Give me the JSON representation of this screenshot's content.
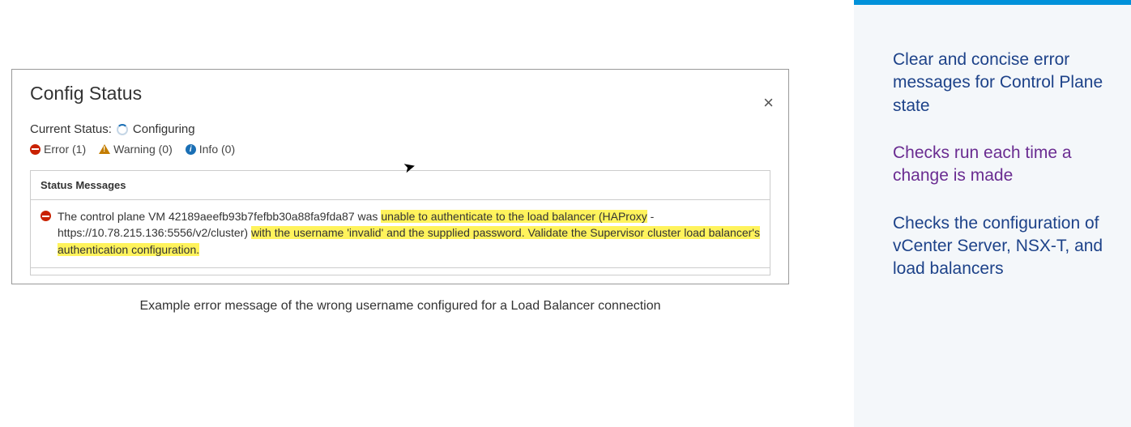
{
  "dialog": {
    "title": "Config Status",
    "current_status_label": "Current Status:",
    "current_status_value": "Configuring",
    "counts": {
      "error_label": "Error (1)",
      "warning_label": "Warning (0)",
      "info_label": "Info (0)"
    },
    "messages_header": "Status Messages",
    "message": {
      "pre1": "The control plane VM 42189aeefb93b7fefbb30a88fa9fda87 was ",
      "hl1": "unable to authenticate to the load balancer (HAProxy",
      "mid1": " - https://10.78.215.136:5556/v2/cluster) ",
      "hl2": "with the username 'invalid' and the supplied password. Validate the Supervisor cluster load balancer's authentication configuration."
    }
  },
  "caption": "Example error message of the wrong username configured for a Load Balancer connection",
  "sidebar": {
    "item1": "Clear and concise error messages for Control Plane state",
    "item2": "Checks run each time a change is made",
    "item3": "Checks the configuration of vCenter Server, NSX-T, and load balancers"
  }
}
